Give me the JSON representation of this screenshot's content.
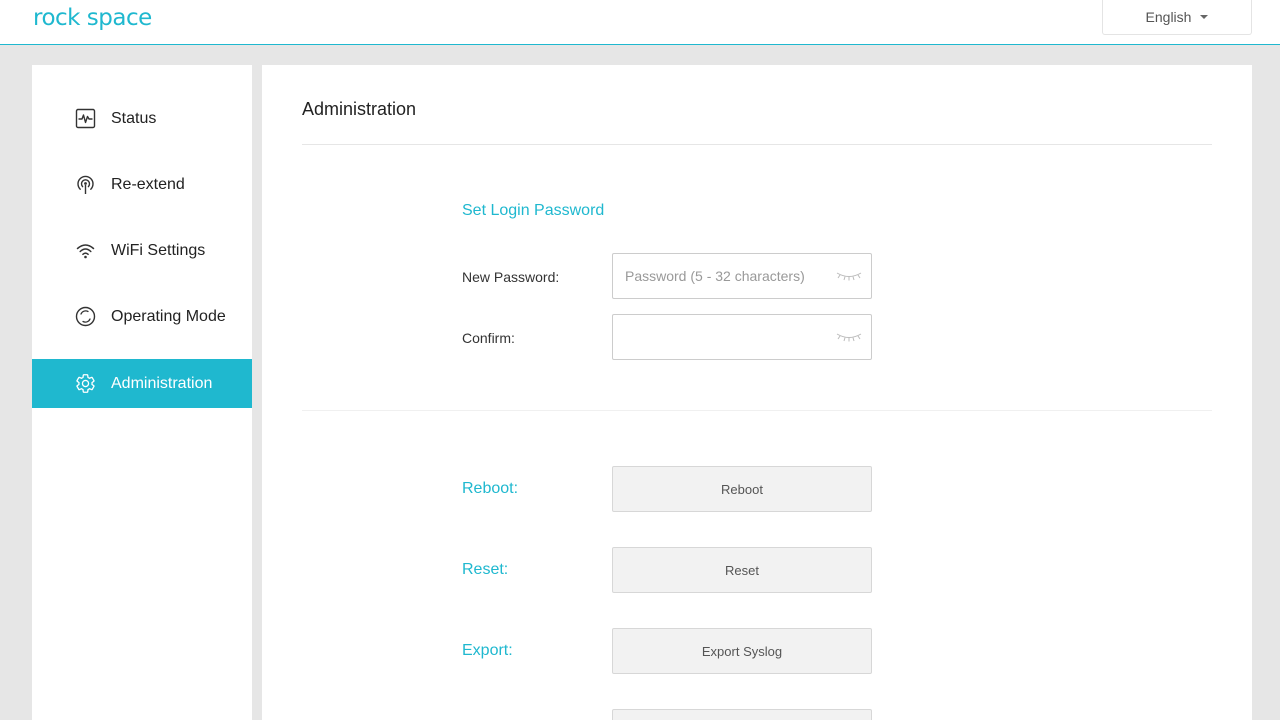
{
  "header": {
    "logo": "rock space",
    "language": "English"
  },
  "sidebar": {
    "items": [
      {
        "label": "Status",
        "icon": "status-pulse-icon"
      },
      {
        "label": "Re-extend",
        "icon": "antenna-icon"
      },
      {
        "label": "WiFi Settings",
        "icon": "wifi-icon"
      },
      {
        "label": "Operating Mode",
        "icon": "operating-mode-icon"
      },
      {
        "label": "Administration",
        "icon": "gear-icon",
        "active": true
      }
    ]
  },
  "main": {
    "title": "Administration",
    "password_section": {
      "title": "Set Login Password",
      "new_password_label": "New Password:",
      "new_password_placeholder": "Password (5 - 32 characters)",
      "new_password_value": "",
      "confirm_label": "Confirm:",
      "confirm_value": ""
    },
    "actions": [
      {
        "label": "Reboot:",
        "button": "Reboot"
      },
      {
        "label": "Reset:",
        "button": "Reset"
      },
      {
        "label": "Export:",
        "button": "Export Syslog"
      }
    ]
  },
  "colors": {
    "accent": "#1fb8cf",
    "background": "#e6e6e6",
    "button_bg": "#f2f2f2"
  }
}
